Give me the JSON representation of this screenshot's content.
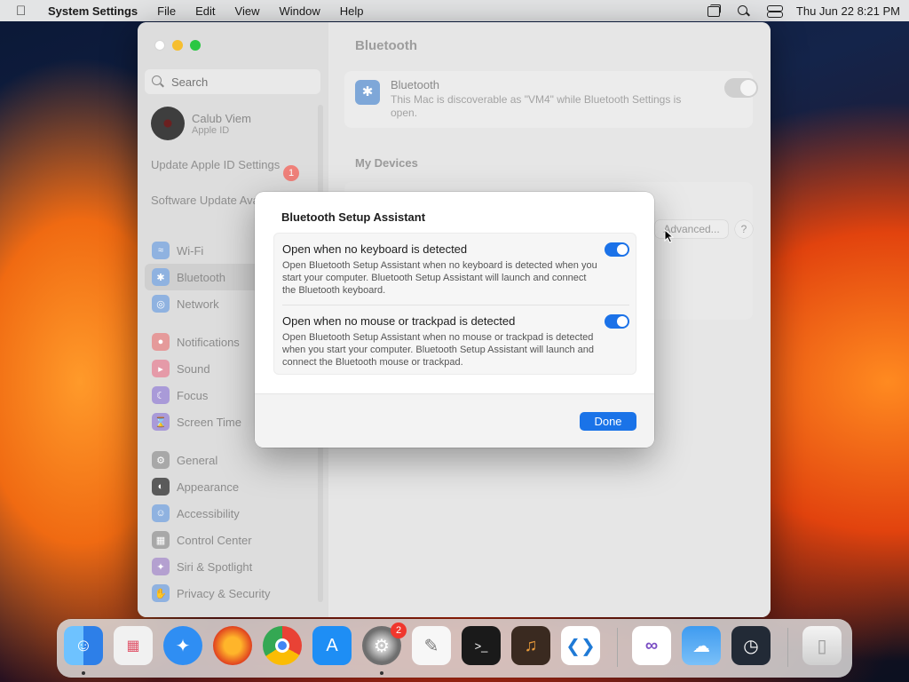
{
  "menubar": {
    "app_name": "System Settings",
    "menus": [
      "File",
      "Edit",
      "View",
      "Window",
      "Help"
    ],
    "clock": "Thu Jun 22  8:21 PM"
  },
  "sidebar": {
    "search_placeholder": "Search",
    "account": {
      "name": "Calub Viem",
      "subtitle": "Apple ID"
    },
    "notices": [
      {
        "label": "Update Apple ID Settings",
        "badge": "1"
      },
      {
        "label": "Software Update Available"
      }
    ],
    "groups": [
      [
        {
          "label": "Wi-Fi",
          "icon": "wifi-icon",
          "color": "#8fb2e0"
        },
        {
          "label": "Bluetooth",
          "icon": "bluetooth-icon",
          "color": "#8fb2e0",
          "active": true
        },
        {
          "label": "Network",
          "icon": "globe-icon",
          "color": "#8fb2e0"
        }
      ],
      [
        {
          "label": "Notifications",
          "icon": "bell-icon",
          "color": "#e59a9a"
        },
        {
          "label": "Sound",
          "icon": "speaker-icon",
          "color": "#e59aa8"
        },
        {
          "label": "Focus",
          "icon": "moon-icon",
          "color": "#a99ad8"
        },
        {
          "label": "Screen Time",
          "icon": "hourglass-icon",
          "color": "#a99ad8"
        }
      ],
      [
        {
          "label": "General",
          "icon": "gear-icon",
          "color": "#a8a8a8"
        },
        {
          "label": "Appearance",
          "icon": "appearance-icon",
          "color": "#5a5a5a"
        },
        {
          "label": "Accessibility",
          "icon": "accessibility-icon",
          "color": "#8fb2e0"
        },
        {
          "label": "Control Center",
          "icon": "control-center-icon",
          "color": "#a8a8a8"
        },
        {
          "label": "Siri & Spotlight",
          "icon": "siri-icon",
          "color": "#b4a0d0"
        },
        {
          "label": "Privacy & Security",
          "icon": "hand-icon",
          "color": "#8fb2e0"
        }
      ]
    ]
  },
  "main": {
    "title": "Bluetooth",
    "bluetooth_card": {
      "label": "Bluetooth",
      "description": "This Mac is discoverable as \"VM4\" while Bluetooth Settings is open."
    },
    "my_devices_heading": "My Devices",
    "advanced_button": "Advanced...",
    "help_button": "?"
  },
  "dialog": {
    "title": "Bluetooth Setup Assistant",
    "options": [
      {
        "title": "Open when no keyboard is detected",
        "description": "Open Bluetooth Setup Assistant when no keyboard is detected when you start your computer. Bluetooth Setup Assistant will launch and connect the Bluetooth keyboard.",
        "enabled": true
      },
      {
        "title": "Open when no mouse or trackpad is detected",
        "description": "Open Bluetooth Setup Assistant when no mouse or trackpad is detected when you start your computer. Bluetooth Setup Assistant will launch and connect the Bluetooth mouse or trackpad.",
        "enabled": true
      }
    ],
    "done_button": "Done"
  },
  "dock": {
    "apps": [
      {
        "name": "finder-icon",
        "color": "#3b8ff0",
        "running": true
      },
      {
        "name": "launchpad-icon",
        "color": "#e8e8e8"
      },
      {
        "name": "safari-icon",
        "color": "#2f8ef3"
      },
      {
        "name": "firefox-icon",
        "color": "#8a2cd6"
      },
      {
        "name": "chrome-icon",
        "color": "#ffffff"
      },
      {
        "name": "app-store-icon",
        "color": "#1e8ef5"
      },
      {
        "name": "system-settings-icon",
        "color": "#8a8a8a",
        "running": true,
        "badge": "2"
      },
      {
        "name": "textedit-icon",
        "color": "#f7f7f7"
      },
      {
        "name": "terminal-icon",
        "color": "#1a1a1a"
      },
      {
        "name": "garageband-icon",
        "color": "#3a2a20"
      },
      {
        "name": "vscode-icon",
        "color": "#ffffff"
      },
      {
        "name": "visual-studio-icon",
        "color": "#ffffff"
      },
      {
        "name": "weather-icon",
        "color": "#3f9bf0"
      },
      {
        "name": "activity-monitor-icon",
        "color": "#222a36"
      },
      {
        "name": "trash-icon",
        "color": "#dcdcdc"
      }
    ]
  }
}
